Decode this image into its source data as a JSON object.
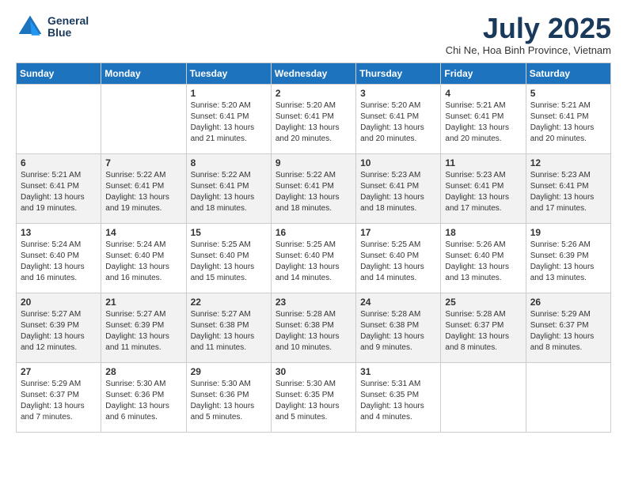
{
  "header": {
    "logo_line1": "General",
    "logo_line2": "Blue",
    "month_year": "July 2025",
    "location": "Chi Ne, Hoa Binh Province, Vietnam"
  },
  "days_of_week": [
    "Sunday",
    "Monday",
    "Tuesday",
    "Wednesday",
    "Thursday",
    "Friday",
    "Saturday"
  ],
  "weeks": [
    [
      {
        "day": "",
        "info": ""
      },
      {
        "day": "",
        "info": ""
      },
      {
        "day": "1",
        "info": "Sunrise: 5:20 AM\nSunset: 6:41 PM\nDaylight: 13 hours and 21 minutes."
      },
      {
        "day": "2",
        "info": "Sunrise: 5:20 AM\nSunset: 6:41 PM\nDaylight: 13 hours and 20 minutes."
      },
      {
        "day": "3",
        "info": "Sunrise: 5:20 AM\nSunset: 6:41 PM\nDaylight: 13 hours and 20 minutes."
      },
      {
        "day": "4",
        "info": "Sunrise: 5:21 AM\nSunset: 6:41 PM\nDaylight: 13 hours and 20 minutes."
      },
      {
        "day": "5",
        "info": "Sunrise: 5:21 AM\nSunset: 6:41 PM\nDaylight: 13 hours and 20 minutes."
      }
    ],
    [
      {
        "day": "6",
        "info": "Sunrise: 5:21 AM\nSunset: 6:41 PM\nDaylight: 13 hours and 19 minutes."
      },
      {
        "day": "7",
        "info": "Sunrise: 5:22 AM\nSunset: 6:41 PM\nDaylight: 13 hours and 19 minutes."
      },
      {
        "day": "8",
        "info": "Sunrise: 5:22 AM\nSunset: 6:41 PM\nDaylight: 13 hours and 18 minutes."
      },
      {
        "day": "9",
        "info": "Sunrise: 5:22 AM\nSunset: 6:41 PM\nDaylight: 13 hours and 18 minutes."
      },
      {
        "day": "10",
        "info": "Sunrise: 5:23 AM\nSunset: 6:41 PM\nDaylight: 13 hours and 18 minutes."
      },
      {
        "day": "11",
        "info": "Sunrise: 5:23 AM\nSunset: 6:41 PM\nDaylight: 13 hours and 17 minutes."
      },
      {
        "day": "12",
        "info": "Sunrise: 5:23 AM\nSunset: 6:41 PM\nDaylight: 13 hours and 17 minutes."
      }
    ],
    [
      {
        "day": "13",
        "info": "Sunrise: 5:24 AM\nSunset: 6:40 PM\nDaylight: 13 hours and 16 minutes."
      },
      {
        "day": "14",
        "info": "Sunrise: 5:24 AM\nSunset: 6:40 PM\nDaylight: 13 hours and 16 minutes."
      },
      {
        "day": "15",
        "info": "Sunrise: 5:25 AM\nSunset: 6:40 PM\nDaylight: 13 hours and 15 minutes."
      },
      {
        "day": "16",
        "info": "Sunrise: 5:25 AM\nSunset: 6:40 PM\nDaylight: 13 hours and 14 minutes."
      },
      {
        "day": "17",
        "info": "Sunrise: 5:25 AM\nSunset: 6:40 PM\nDaylight: 13 hours and 14 minutes."
      },
      {
        "day": "18",
        "info": "Sunrise: 5:26 AM\nSunset: 6:40 PM\nDaylight: 13 hours and 13 minutes."
      },
      {
        "day": "19",
        "info": "Sunrise: 5:26 AM\nSunset: 6:39 PM\nDaylight: 13 hours and 13 minutes."
      }
    ],
    [
      {
        "day": "20",
        "info": "Sunrise: 5:27 AM\nSunset: 6:39 PM\nDaylight: 13 hours and 12 minutes."
      },
      {
        "day": "21",
        "info": "Sunrise: 5:27 AM\nSunset: 6:39 PM\nDaylight: 13 hours and 11 minutes."
      },
      {
        "day": "22",
        "info": "Sunrise: 5:27 AM\nSunset: 6:38 PM\nDaylight: 13 hours and 11 minutes."
      },
      {
        "day": "23",
        "info": "Sunrise: 5:28 AM\nSunset: 6:38 PM\nDaylight: 13 hours and 10 minutes."
      },
      {
        "day": "24",
        "info": "Sunrise: 5:28 AM\nSunset: 6:38 PM\nDaylight: 13 hours and 9 minutes."
      },
      {
        "day": "25",
        "info": "Sunrise: 5:28 AM\nSunset: 6:37 PM\nDaylight: 13 hours and 8 minutes."
      },
      {
        "day": "26",
        "info": "Sunrise: 5:29 AM\nSunset: 6:37 PM\nDaylight: 13 hours and 8 minutes."
      }
    ],
    [
      {
        "day": "27",
        "info": "Sunrise: 5:29 AM\nSunset: 6:37 PM\nDaylight: 13 hours and 7 minutes."
      },
      {
        "day": "28",
        "info": "Sunrise: 5:30 AM\nSunset: 6:36 PM\nDaylight: 13 hours and 6 minutes."
      },
      {
        "day": "29",
        "info": "Sunrise: 5:30 AM\nSunset: 6:36 PM\nDaylight: 13 hours and 5 minutes."
      },
      {
        "day": "30",
        "info": "Sunrise: 5:30 AM\nSunset: 6:35 PM\nDaylight: 13 hours and 5 minutes."
      },
      {
        "day": "31",
        "info": "Sunrise: 5:31 AM\nSunset: 6:35 PM\nDaylight: 13 hours and 4 minutes."
      },
      {
        "day": "",
        "info": ""
      },
      {
        "day": "",
        "info": ""
      }
    ]
  ]
}
